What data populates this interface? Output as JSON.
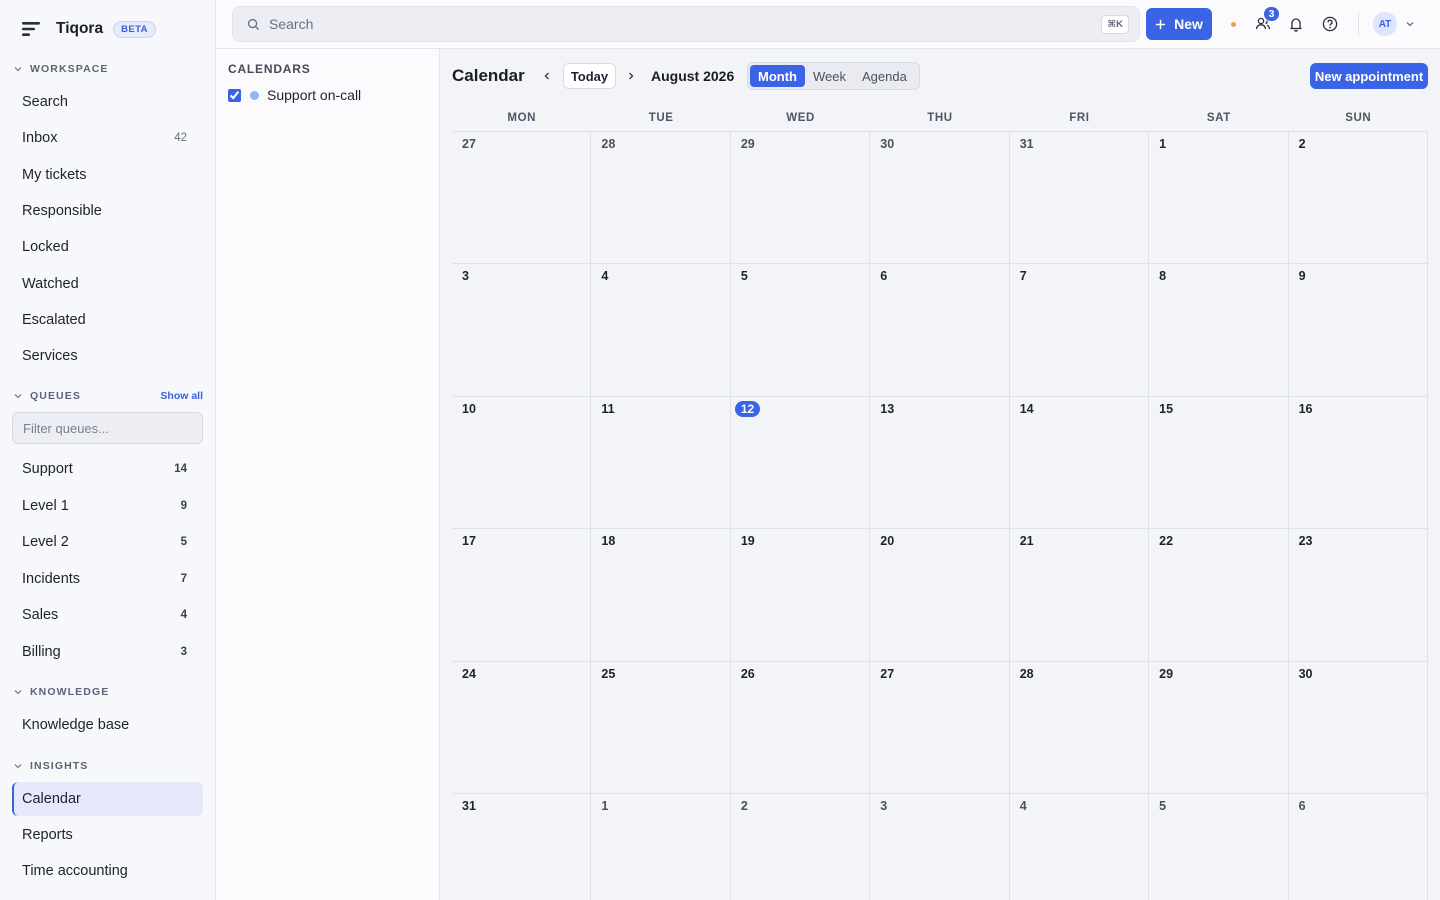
{
  "brand": {
    "name": "Tiqora",
    "badge": "BETA"
  },
  "sidebar": {
    "workspace": {
      "heading": "WORKSPACE",
      "items": [
        {
          "label": "Search",
          "count": ""
        },
        {
          "label": "Inbox",
          "count": "42"
        },
        {
          "label": "My tickets",
          "count": ""
        },
        {
          "label": "Responsible",
          "count": ""
        },
        {
          "label": "Locked",
          "count": ""
        },
        {
          "label": "Watched",
          "count": ""
        },
        {
          "label": "Escalated",
          "count": ""
        },
        {
          "label": "Services",
          "count": ""
        }
      ]
    },
    "queues": {
      "heading": "QUEUES",
      "show_all": "Show all",
      "filter_placeholder": "Filter queues...",
      "items": [
        {
          "label": "Support",
          "count": "14"
        },
        {
          "label": "Level 1",
          "count": "9"
        },
        {
          "label": "Level 2",
          "count": "5"
        },
        {
          "label": "Incidents",
          "count": "7"
        },
        {
          "label": "Sales",
          "count": "4"
        },
        {
          "label": "Billing",
          "count": "3"
        }
      ]
    },
    "knowledge": {
      "heading": "KNOWLEDGE",
      "items": [
        {
          "label": "Knowledge base"
        }
      ]
    },
    "insights": {
      "heading": "INSIGHTS",
      "items": [
        {
          "label": "Calendar",
          "active": true
        },
        {
          "label": "Reports"
        },
        {
          "label": "Time accounting"
        }
      ]
    }
  },
  "topbar": {
    "search_placeholder": "Search",
    "shortcut": "⌘K",
    "new_label": "New",
    "notif_count": "3",
    "avatar_initials": "AT"
  },
  "calendars_panel": {
    "title": "CALENDARS",
    "entries": [
      {
        "label": "Support on-call",
        "checked": true,
        "color": "#8fb7f0"
      }
    ]
  },
  "calendar": {
    "title": "Calendar",
    "today_label": "Today",
    "month_label": "August 2026",
    "views": [
      "Month",
      "Week",
      "Agenda"
    ],
    "active_view": "Month",
    "new_appointment": "New appointment",
    "weekdays": [
      "MON",
      "TUE",
      "WED",
      "THU",
      "FRI",
      "SAT",
      "SUN"
    ],
    "weeks": [
      [
        "27",
        "28",
        "29",
        "30",
        "31",
        "1",
        "2"
      ],
      [
        "3",
        "4",
        "5",
        "6",
        "7",
        "8",
        "9"
      ],
      [
        "10",
        "11",
        "12",
        "13",
        "14",
        "15",
        "16"
      ],
      [
        "17",
        "18",
        "19",
        "20",
        "21",
        "22",
        "23"
      ],
      [
        "24",
        "25",
        "26",
        "27",
        "28",
        "29",
        "30"
      ],
      [
        "31",
        "1",
        "2",
        "3",
        "4",
        "5",
        "6"
      ]
    ],
    "today_day": "12",
    "accent": "#3b63e6"
  }
}
